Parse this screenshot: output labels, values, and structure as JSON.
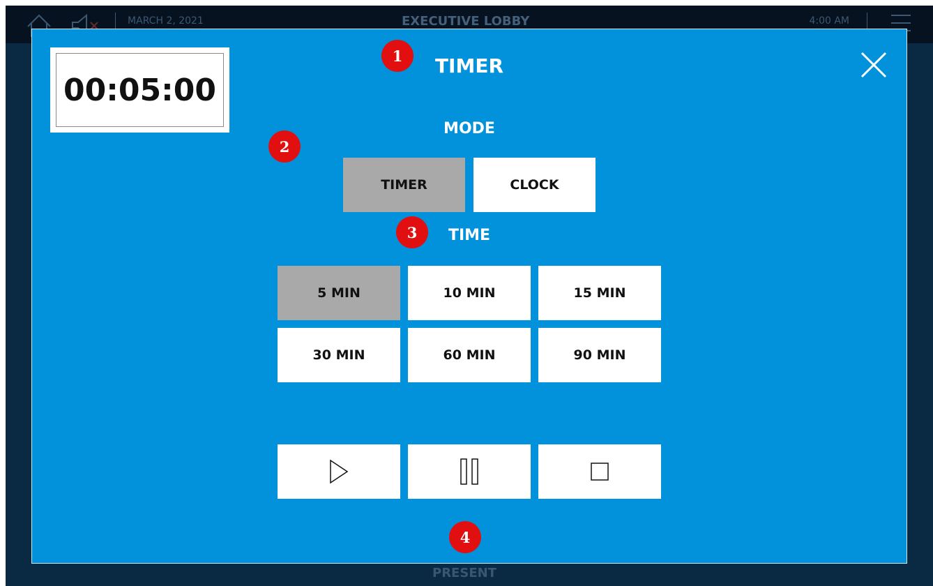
{
  "background": {
    "date": "MARCH 2, 2021",
    "room": "EXECUTIVE LOBBY",
    "time": "4:00 AM",
    "bottom_label": "PRESENT"
  },
  "modal": {
    "title": "TIMER",
    "countdown": "00:05:00",
    "mode_heading": "MODE",
    "mode_options": [
      {
        "label": "TIMER",
        "selected": true
      },
      {
        "label": "CLOCK",
        "selected": false
      }
    ],
    "time_heading": "TIME",
    "time_options": [
      {
        "label": "5 MIN",
        "selected": true
      },
      {
        "label": "10 MIN",
        "selected": false
      },
      {
        "label": "15 MIN",
        "selected": false
      },
      {
        "label": "30 MIN",
        "selected": false
      },
      {
        "label": "60 MIN",
        "selected": false
      },
      {
        "label": "90 MIN",
        "selected": false
      }
    ],
    "controls": [
      {
        "icon": "play-icon"
      },
      {
        "icon": "pause-icon"
      },
      {
        "icon": "stop-icon"
      }
    ],
    "close_icon": "close-icon"
  },
  "annotations": [
    "1",
    "2",
    "3",
    "4"
  ],
  "colors": {
    "modal_bg": "#0292dc",
    "selected_button": "#a9a9a9",
    "badge": "#e10f0f"
  }
}
